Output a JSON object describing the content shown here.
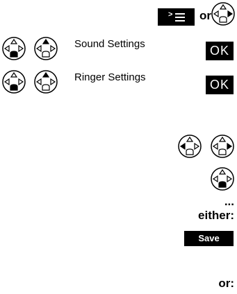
{
  "header": {
    "or_label": "or"
  },
  "rows": [
    {
      "label": "Sound Settings",
      "ok_label": "OK"
    },
    {
      "label": "Ringer Settings",
      "ok_label": "OK"
    }
  ],
  "steps": {
    "ellipsis": "...",
    "either": "either:",
    "save_label": "Save",
    "or2": "or:"
  },
  "colors": {
    "key_background": "#000000",
    "key_text": "#ffffff"
  }
}
